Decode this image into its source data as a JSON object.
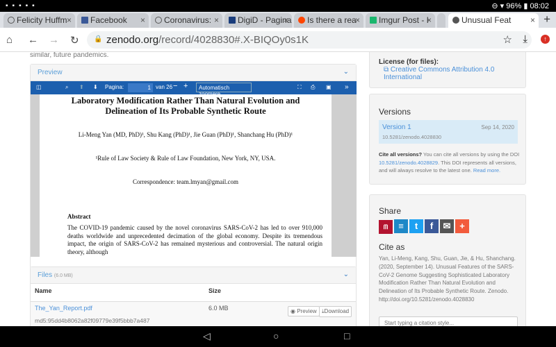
{
  "status": {
    "battery": "96%",
    "time": "08:02"
  },
  "tabs": [
    {
      "title": "Felicity Huffm",
      "favicon": "#555"
    },
    {
      "title": "Facebook",
      "favicon": "#3b5998"
    },
    {
      "title": "Coronavirus:",
      "favicon": "#555"
    },
    {
      "title": "DigiD - Pagina",
      "favicon": "#1a3d7c"
    },
    {
      "title": "Is there a rea",
      "favicon": "#ff4500"
    },
    {
      "title": "Imgur Post - I",
      "favicon": "#1bb76e"
    },
    {
      "title": "Unusual Feat",
      "favicon": "#555"
    }
  ],
  "address": {
    "host": "zenodo.org",
    "path": "/record/4028830#.X-BIQOy0s1K"
  },
  "description_tail": "similar, future pandemics.",
  "preview": {
    "title": "Preview",
    "toolbar": {
      "page_label": "Pagina:",
      "page": "1",
      "of": "van 26",
      "zoom": "Automatisch zoomere"
    },
    "pdf": {
      "title": "Laboratory Modification Rather Than Natural Evolution and Delineation of Its Probable Synthetic Route",
      "authors": "Li-Meng Yan (MD, PhD)¹, Shu Kang (PhD)¹, Jie Guan (PhD)¹, Shanchang Hu (PhD)¹",
      "affiliation": "¹Rule of Law Society & Rule of Law Foundation, New York, NY, USA.",
      "correspondence": "Correspondence: team.lmyan@gmail.com",
      "abstract_heading": "Abstract",
      "abstract": "The COVID-19 pandemic caused by the novel coronavirus SARS-CoV-2 has led to over 910,000 deaths worldwide and unprecedented decimation of the global economy. Despite its tremendous impact, the origin of SARS-CoV-2 has remained mysterious and controversial. The natural origin theory, although"
    }
  },
  "files": {
    "title": "Files",
    "size_total": "(6.0 MB)",
    "columns": [
      "Name",
      "Size"
    ],
    "rows": [
      {
        "name": "The_Yan_Report.pdf",
        "size": "6.0 MB",
        "md5": "md5:95dd4b8062a82f09779e39f5bbb7a487",
        "preview": "Preview",
        "download": "Download"
      }
    ]
  },
  "license": {
    "label": "License (for files):",
    "value": "Creative Commons Attribution 4.0 International"
  },
  "versions": {
    "title": "Versions",
    "item": {
      "label": "Version 1",
      "date": "Sep 14, 2020",
      "doi": "10.5281/zenodo.4028830"
    },
    "cite_all_bold": "Cite all versions?",
    "cite_all_text1": " You can cite all versions by using the DOI ",
    "cite_all_doi": "10.5281/zenodo.4028829",
    "cite_all_text2": ". This DOI represents all versions, and will always resolve to the latest one. ",
    "read_more": "Read more."
  },
  "share": {
    "title": "Share",
    "colors": [
      "#b3132f",
      "#1e88c7",
      "#1da1f2",
      "#3b5998",
      "#555555",
      "#f25b3c"
    ]
  },
  "cite_as": {
    "title": "Cite as",
    "text": "Yan, Li-Meng, Kang, Shu, Guan, Jie, & Hu, Shanchang. (2020, September 14). Unusual Features of the SARS-CoV-2 Genome Suggesting Sophisticated Laboratory Modification Rather Than Natural Evolution and Delineation of Its Probable Synthetic Route. Zenodo. http://doi.org/10.5281/zenodo.4028830",
    "placeholder": "Start typing a citation style..."
  }
}
